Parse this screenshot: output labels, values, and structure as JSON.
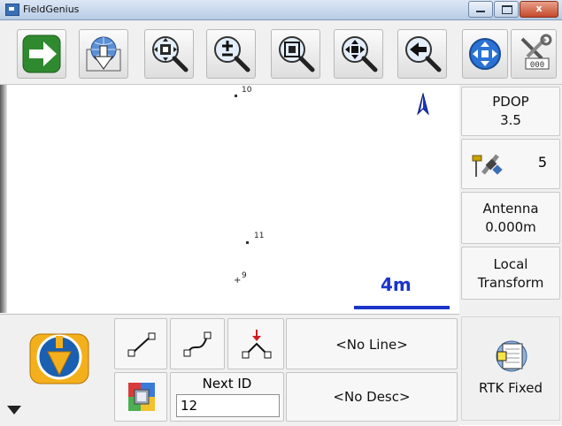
{
  "window": {
    "title": "FieldGenius",
    "minimize": "–",
    "maximize": "□",
    "close": "x"
  },
  "toolbar": {
    "buttons": [
      {
        "name": "continue",
        "icon": "arrow-right-icon"
      },
      {
        "name": "download",
        "icon": "globe-download-icon"
      },
      {
        "name": "zoom-extents",
        "icon": "zoom-extents-icon"
      },
      {
        "name": "zoom-in-out",
        "icon": "zoom-plusminus-icon"
      },
      {
        "name": "zoom-window",
        "icon": "zoom-window-icon"
      },
      {
        "name": "pan",
        "icon": "pan-icon"
      },
      {
        "name": "zoom-previous",
        "icon": "zoom-previous-icon"
      },
      {
        "name": "navigation",
        "icon": "compass-icon"
      },
      {
        "name": "tools",
        "icon": "tools-icon"
      }
    ]
  },
  "map": {
    "points": [
      {
        "id": "10"
      },
      {
        "id": "11"
      },
      {
        "id": "9"
      }
    ],
    "scale_label": "4m",
    "colors": {
      "scale": "#1b35c8"
    }
  },
  "status_panel": {
    "pdop_label": "PDOP",
    "pdop_value": "3.5",
    "satellites": "5",
    "antenna_label": "Antenna",
    "antenna_value": "0.000m",
    "transform_line1": "Local",
    "transform_line2": "Transform",
    "rtk_status": "RTK Fixed"
  },
  "bottom": {
    "line_value": "<No Line>",
    "desc_value": "<No Desc>",
    "next_id_label": "Next ID",
    "next_id_value": "12"
  }
}
